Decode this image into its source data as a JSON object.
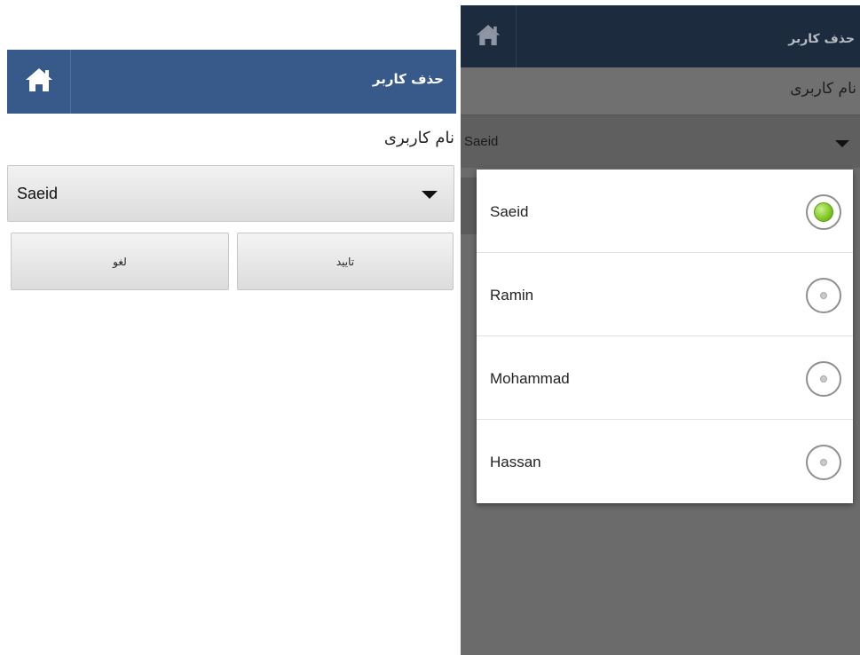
{
  "left": {
    "appbar": {
      "title": "حذف کاربر",
      "home_icon": "home-icon"
    },
    "field_label": "نام کاربری",
    "spinner": {
      "selected": "Saeid"
    },
    "buttons": {
      "cancel": "لغو",
      "confirm": "تایید"
    }
  },
  "right": {
    "appbar": {
      "title": "حذف کاربر",
      "home_icon": "home-icon"
    },
    "field_label": "نام کاربری",
    "spinner": {
      "selected": "Saeid"
    },
    "dialog": {
      "options": [
        {
          "label": "Saeid",
          "checked": true
        },
        {
          "label": "Ramin",
          "checked": false
        },
        {
          "label": "Mohammad",
          "checked": false
        },
        {
          "label": "Hassan",
          "checked": false
        }
      ]
    }
  },
  "colors": {
    "appbar": "#375a8b",
    "appbar_dimmed": "#1d2b3f",
    "radio_selected": "#7dc623",
    "overlay": "#6b6b6b"
  }
}
